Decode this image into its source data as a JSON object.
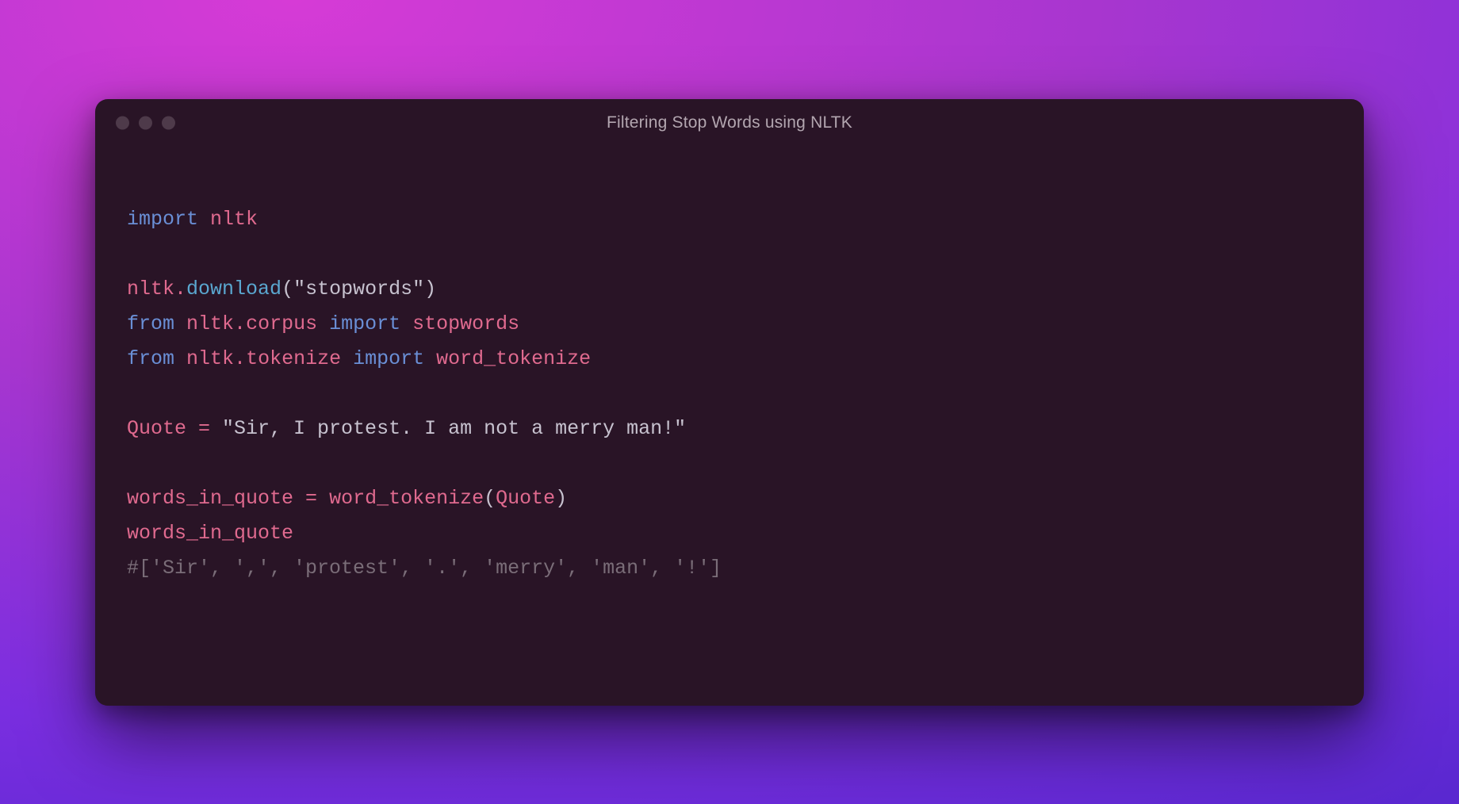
{
  "window": {
    "title": "Filtering Stop Words using NLTK"
  },
  "code": {
    "kw_import": "import",
    "kw_from": "from",
    "nltk": "nltk",
    "dot": ".",
    "download": "download",
    "lparen": "(",
    "rparen": ")",
    "str_stopwords": "\"stopwords\"",
    "corpus": "corpus",
    "tokenize": "tokenize",
    "stopwords": "stopwords",
    "word_tokenize": "word_tokenize",
    "Quote": "Quote",
    "eq": " = ",
    "quote_str": "\"Sir, I protest. I am not a merry man!\"",
    "words_in_quote": "words_in_quote",
    "comment": "#['Sir', ',', 'protest', '.', 'merry', 'man', '!']"
  }
}
